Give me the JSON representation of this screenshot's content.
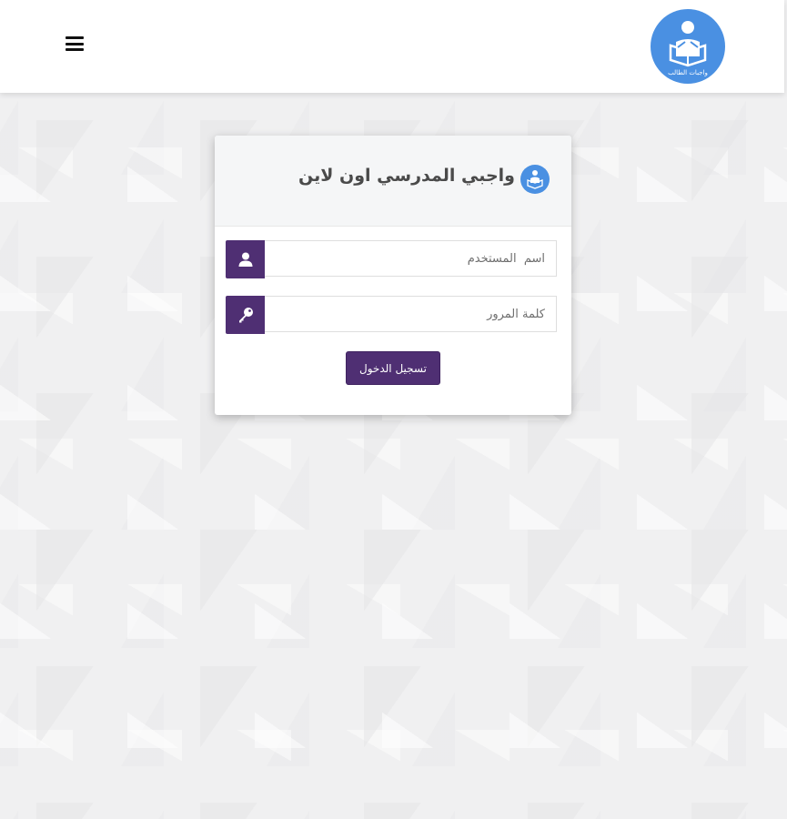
{
  "header": {
    "menu_icon": "hamburger-menu-icon",
    "logo_icon": "student-reading-book-icon",
    "logo_color": "#4a90e2",
    "logo_caption": "واجبات الطالب"
  },
  "login": {
    "title": "واجبي المدرسي اون لاين",
    "title_icon": "student-reading-book-icon",
    "username": {
      "placeholder": "اسم  المستخدم",
      "value": "",
      "icon": "user-icon"
    },
    "password": {
      "placeholder": "كلمة المرور",
      "value": "",
      "icon": "key-icon"
    },
    "submit_label": "تسجيل الدخول"
  },
  "colors": {
    "accent": "#4f2f73",
    "brand_blue": "#4a90e2",
    "background": "#f1f1f2"
  }
}
